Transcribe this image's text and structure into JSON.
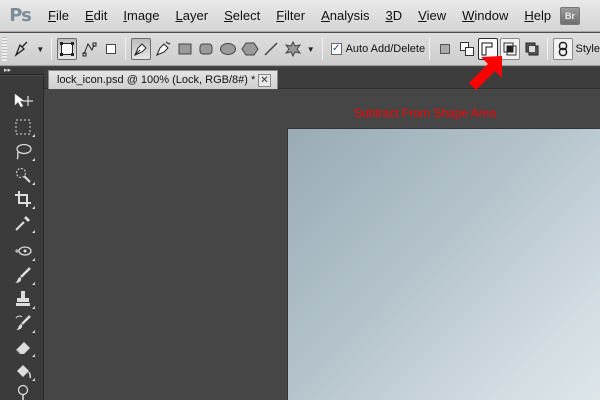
{
  "app": {
    "logo": "Ps",
    "bridge_label": "Br"
  },
  "menu": [
    {
      "label": "File",
      "key": "F",
      "rest": "ile"
    },
    {
      "label": "Edit",
      "key": "E",
      "rest": "dit"
    },
    {
      "label": "Image",
      "key": "I",
      "rest": "mage"
    },
    {
      "label": "Layer",
      "key": "L",
      "rest": "ayer"
    },
    {
      "label": "Select",
      "key": "S",
      "rest": "elect"
    },
    {
      "label": "Filter",
      "key": "F",
      "rest": "ilter"
    },
    {
      "label": "Analysis",
      "key": "A",
      "rest": "nalysis"
    },
    {
      "label": "3D",
      "key": "3",
      "rest": "D"
    },
    {
      "label": "View",
      "key": "V",
      "rest": "iew"
    },
    {
      "label": "Window",
      "key": "W",
      "rest": "indow"
    },
    {
      "label": "Help",
      "key": "H",
      "rest": "elp"
    }
  ],
  "options_bar": {
    "auto_add_delete_label": "Auto Add/Delete",
    "auto_add_delete_checked": "✓",
    "style_label": "Style"
  },
  "tools_panel": {
    "collapse_label": "▸▸"
  },
  "document": {
    "tab_title": "lock_icon.psd @ 100% (Lock, RGB/8#) *",
    "close_label": "✕"
  },
  "annotation": {
    "text": "Subtract From Shape Area",
    "color": "#ff0000"
  },
  "colors": {
    "accent_red": "#ff0000",
    "canvas_gradient_start": "#9aabb6",
    "canvas_gradient_end": "#dee6ea"
  }
}
